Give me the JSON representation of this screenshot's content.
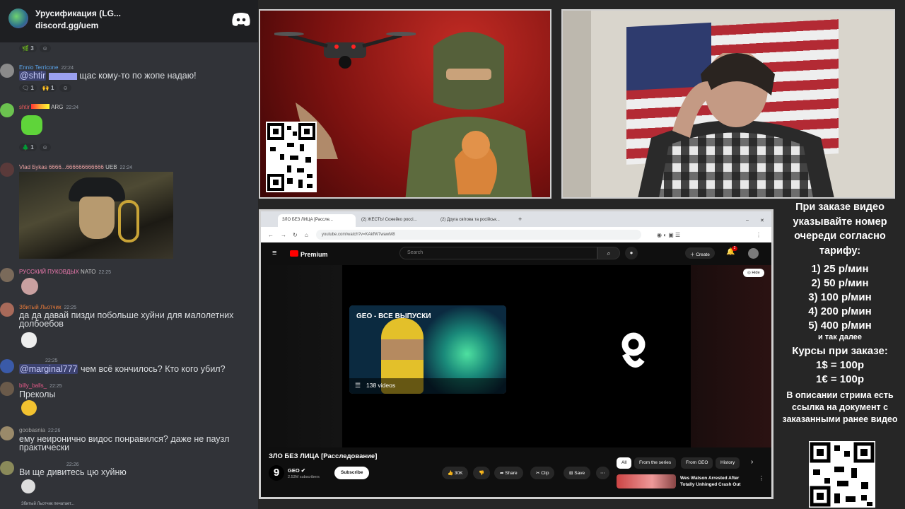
{
  "discord": {
    "server_name": "Урусификация (LG...",
    "invite": "discord.gg/uem",
    "messages": [
      {
        "reactions": [
          "3"
        ]
      },
      {
        "user": "Ennio Terricone",
        "time": "22:24",
        "mention": "@shtir",
        "text": "щас кому-то по жопе надаю!",
        "reactions": [
          "1",
          "1"
        ]
      },
      {
        "user": "shtir",
        "tag": "ARG",
        "time": "22:24",
        "reactions": [
          "1"
        ]
      },
      {
        "user": "Vlad Буkas 6666...666666666666",
        "tag": "UEB",
        "time": "22:24"
      },
      {
        "user": "РУССКИЙ ПУКОВДЫХ",
        "tag": "NATO",
        "time": "22:25"
      },
      {
        "user": "Збитый Льотчик",
        "time": "22:25",
        "text": "да да давай пизди побольше хуйни для малолетних долбоебов"
      },
      {
        "time": "22:25",
        "mention": "@marginal777",
        "text": "чем всё кончилось? Кто кого убил?"
      },
      {
        "user": "billy_balls_",
        "time": "22:25",
        "text": "Преколы"
      },
      {
        "user": "goobasnia",
        "time": "22:26",
        "text": "ему неиронично видос понравился? даже не паузл практически"
      },
      {
        "time": "22:26",
        "text": "Ви ще дивитесь цю хуйню"
      }
    ],
    "typing": "Збитый Льотчик печатает..."
  },
  "browser": {
    "tabs": [
      "ЗЛО БЕЗ ЛИЦА [Рассле...",
      "(2) ЖЕСТЬ! Сожейко россі...",
      "(2) Друга світова та російськ..."
    ],
    "url": "youtube.com/watch?v=KAkfW7wawM8"
  },
  "youtube": {
    "brand": "Premium",
    "search_placeholder": "Search",
    "create": "Create",
    "notif_count": "2",
    "hide": "Hide",
    "card_title": "GEO - ВСЕ ВЫПУСКИ",
    "card_count": "138 videos",
    "video_title": "ЗЛО БЕЗ ЛИЦА [Расследование]",
    "channel": "GEO",
    "subscribers": "2.53M subscribers",
    "subscribe": "Subscribe",
    "likes": "30K",
    "share": "Share",
    "clip": "Clip",
    "save": "Save",
    "chips": [
      "All",
      "From the series",
      "From GEO",
      "History"
    ],
    "rec_title": "Wes Watson Arrested After Totally Unhinged Crash Out"
  },
  "info": {
    "heading": "При заказе видео указывайте номер очереди согласно тарифу:",
    "tariffs": [
      "1) 25 р/мин",
      "2) 50 р/мин",
      "3) 100 р/мин",
      "4) 200 р/мин",
      "5) 400 р/мин"
    ],
    "etc": "и так далее",
    "rates_heading": "Курсы при заказе:",
    "rates": [
      "1$ = 100р",
      "1€ = 100р"
    ],
    "note": "В описании стрима есть ссылка на документ с заказанными ранее видео"
  }
}
